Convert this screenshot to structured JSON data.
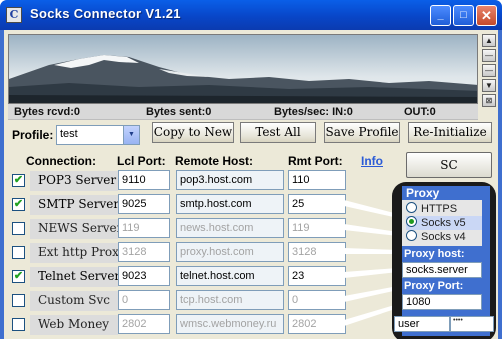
{
  "window": {
    "title": "Socks Connector V1.21",
    "app_icon_letter": "C",
    "controls": {
      "minimize": "_",
      "maximize": "□",
      "close": "✕"
    }
  },
  "banner": {
    "scroll_icons": [
      "up-arrow",
      "line",
      "line",
      "down-arrow",
      "checkbox"
    ]
  },
  "stats": {
    "bytes_rcvd": "Bytes rcvd:0",
    "bytes_sent": "Bytes sent:0",
    "bytes_sec_in": "Bytes/sec: IN:0",
    "out": "OUT:0"
  },
  "toolbar": {
    "profile_label": "Profile:",
    "profile_value": "test",
    "copy_to_new": "Copy to New",
    "test_all": "Test All",
    "save_profile": "Save Profile",
    "reinitialize": "Re-Initialize"
  },
  "grid": {
    "headers": {
      "connection": "Connection:",
      "lcl_port": "Lcl Port:",
      "remote_host": "Remote Host:",
      "rmt_port": "Rmt Port:"
    },
    "info_link": "Info",
    "rows": [
      {
        "checked": true,
        "name": "POP3 Server",
        "lcl_port": "9110",
        "remote_host": "pop3.host.com",
        "rmt_port": "110"
      },
      {
        "checked": true,
        "name": "SMTP Server",
        "lcl_port": "9025",
        "remote_host": "smtp.host.com",
        "rmt_port": "25"
      },
      {
        "checked": false,
        "name": "NEWS Server",
        "lcl_port": "119",
        "remote_host": "news.host.com",
        "rmt_port": "119"
      },
      {
        "checked": false,
        "name": "Ext http Proxy",
        "lcl_port": "3128",
        "remote_host": "proxy.host.com",
        "rmt_port": "3128"
      },
      {
        "checked": true,
        "name": "Telnet Server",
        "lcl_port": "9023",
        "remote_host": "telnet.host.com",
        "rmt_port": "23"
      },
      {
        "checked": false,
        "name": "Custom Svc",
        "lcl_port": "0",
        "remote_host": "tcp.host.com",
        "rmt_port": "0"
      },
      {
        "checked": false,
        "name": "Web Money",
        "lcl_port": "2802",
        "remote_host": "wmsc.webmoney.ru",
        "rmt_port": "2802"
      }
    ]
  },
  "sc_homepage": "SC HomePage",
  "proxy": {
    "title": "Proxy",
    "options": [
      {
        "label": "HTTPS",
        "selected": false
      },
      {
        "label": "Socks v5",
        "selected": true
      },
      {
        "label": "Socks v4",
        "selected": false
      }
    ],
    "host_label": "Proxy host:",
    "host_value": "socks.server",
    "port_label": "Proxy Port:",
    "port_value": "1080",
    "user_value": "user",
    "password_value": "••••"
  },
  "colors": {
    "titlebar": "#0846c8",
    "client_bg": "#ece9d8",
    "panel_blue": "#3f6fcf",
    "link": "#2b5bd6",
    "check_green": "#21a121"
  }
}
